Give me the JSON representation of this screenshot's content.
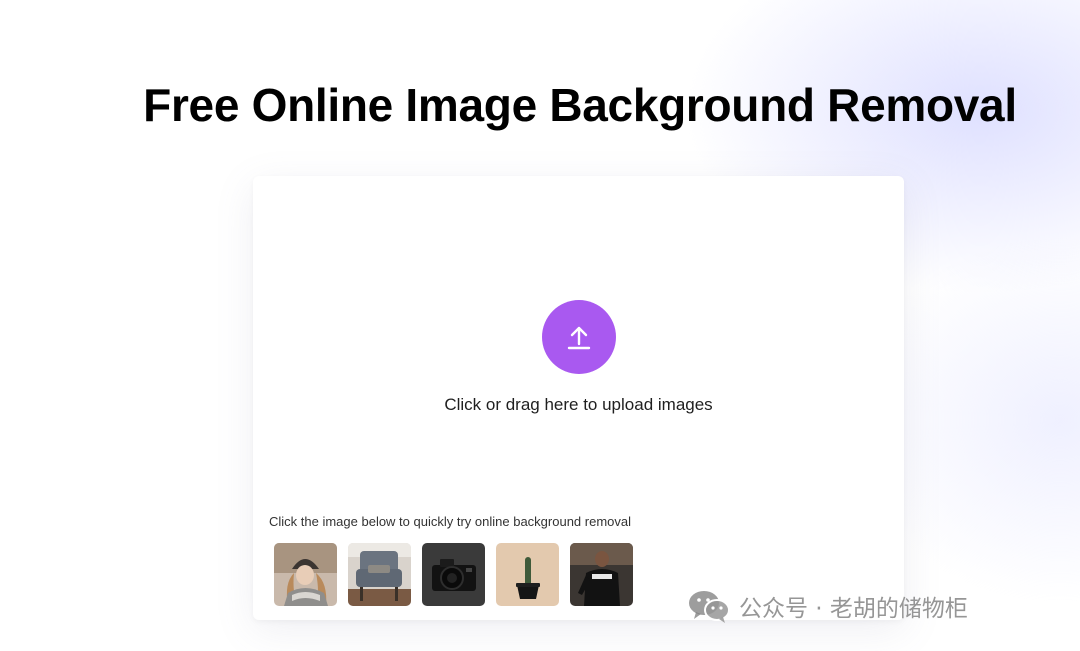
{
  "page": {
    "title": "Free Online Image Background Removal"
  },
  "upload": {
    "icon": "upload-arrow-icon",
    "label": "Click or drag here to upload images",
    "accent_color": "#a959f0"
  },
  "samples": {
    "hint": "Click the image below to quickly try online background removal",
    "items": [
      {
        "subject": "woman in knit hat"
      },
      {
        "subject": "grey armchair"
      },
      {
        "subject": "black camera"
      },
      {
        "subject": "potted cactus"
      },
      {
        "subject": "man in black shirt"
      }
    ]
  },
  "watermark": {
    "icon": "wechat-icon",
    "text": "公众号 · 老胡的储物柜"
  }
}
